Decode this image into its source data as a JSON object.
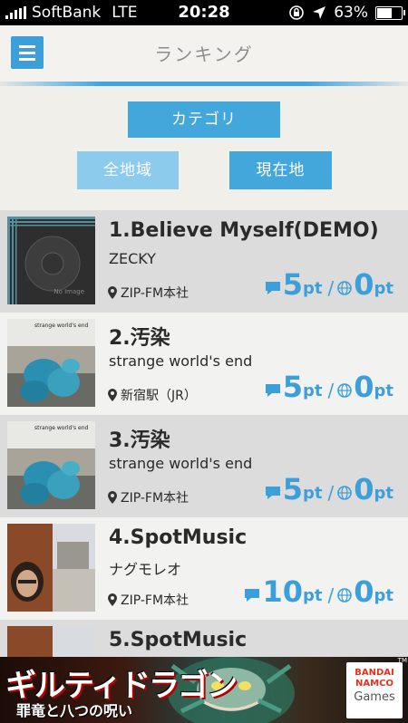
{
  "status_bar": {
    "carrier": "SoftBank",
    "network": "LTE",
    "time": "20:28",
    "battery": "63%",
    "battery_level": 0.63
  },
  "header": {
    "title": "ランキング",
    "menu_icon": "hamburger-menu-icon"
  },
  "filters": {
    "category_label": "カテゴリ",
    "all_regions_label": "全地域",
    "current_location_label": "現在地"
  },
  "rankings": [
    {
      "title": "1.Believe Myself(DEMO)",
      "artist": "ZECKY",
      "location": "ZIP-FM本社",
      "comments": "5",
      "globe": "0",
      "unit": "pt",
      "thumb_text": "No Image"
    },
    {
      "title": "2.汚染",
      "artist": "strange world's end",
      "location": "新宿駅（JR）",
      "comments": "5",
      "globe": "0",
      "unit": "pt",
      "thumb_text": "strange world's end"
    },
    {
      "title": "3.汚染",
      "artist": "strange world's end",
      "location": "ZIP-FM本社",
      "comments": "5",
      "globe": "0",
      "unit": "pt",
      "thumb_text": "strange world's end"
    },
    {
      "title": "4.SpotMusic",
      "artist": "ナグモレオ",
      "location": "ZIP-FM本社",
      "comments": "10",
      "globe": "0",
      "unit": "pt",
      "thumb_text": ""
    },
    {
      "title": "5.SpotMusic",
      "artist": "",
      "location": "",
      "comments": "",
      "globe": "",
      "unit": "",
      "thumb_text": ""
    }
  ],
  "separator": "/",
  "banner": {
    "title": "ギルティドラゴン",
    "subtitle": "罪竜と八つの呪い",
    "brand_line1": "BANDAI",
    "brand_line2": "NAMCO",
    "brand_line3": "Games",
    "trademark": "TM"
  },
  "colors": {
    "accent": "#3d9fda",
    "button_light": "#8ccbeb",
    "row_alt": "#dcdcdc",
    "row_plain": "#f2f2f0"
  }
}
